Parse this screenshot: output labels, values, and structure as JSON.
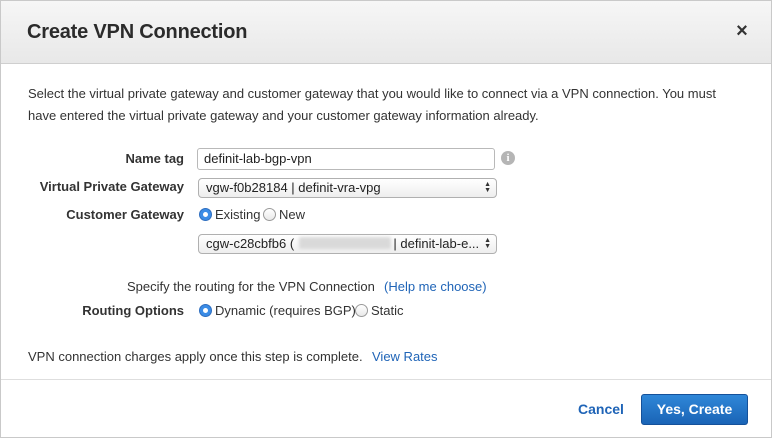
{
  "dialog": {
    "title": "Create VPN Connection",
    "close_glyph": "×"
  },
  "intro_text": "Select the virtual private gateway and customer gateway that you would like to connect via a VPN connection. You must have entered the virtual private gateway and your customer gateway information already.",
  "name_tag": {
    "label": "Name tag",
    "value": "definit-lab-bgp-vpn",
    "info_glyph": "i"
  },
  "virtual_private_gateway": {
    "label": "Virtual Private Gateway",
    "selected": "vgw-f0b28184 | definit-vra-vpg"
  },
  "customer_gateway": {
    "label": "Customer Gateway",
    "options": [
      "Existing",
      "New"
    ],
    "selected_option": "Existing",
    "select_prefix": "cgw-c28cbfb6 (",
    "select_suffix": "| definit-lab-e..."
  },
  "routing": {
    "hint": "Specify the routing for the VPN Connection",
    "help_link": "(Help me choose)",
    "label": "Routing Options",
    "options": [
      "Dynamic (requires BGP)",
      "Static"
    ],
    "selected_option": "Dynamic (requires BGP)"
  },
  "charges": {
    "text": "VPN connection charges apply once this step is complete.",
    "link": "View Rates"
  },
  "footer": {
    "cancel_label": "Cancel",
    "confirm_label": "Yes, Create"
  },
  "colors": {
    "accent": "#1f64b7",
    "primary_button": "#2f87d8",
    "radio_checked": "#3b8ce6"
  }
}
